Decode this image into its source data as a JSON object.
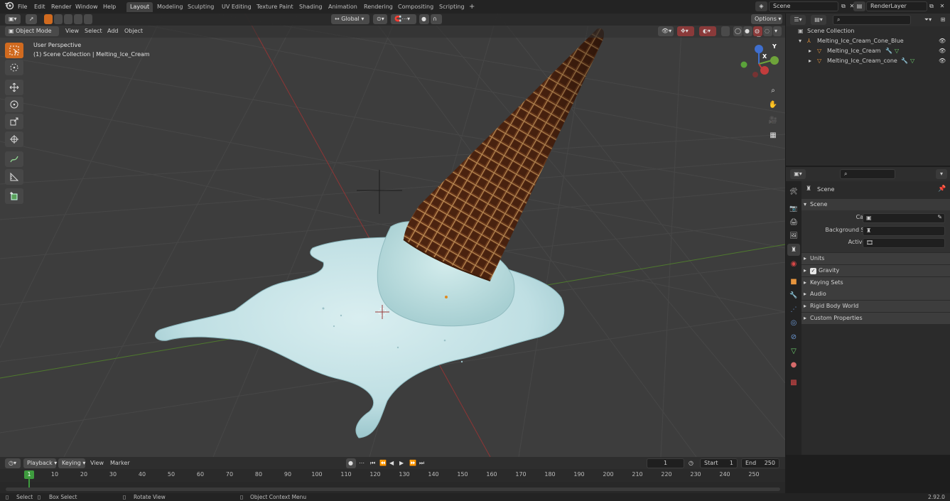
{
  "topbar": {
    "menus": [
      "File",
      "Edit",
      "Render",
      "Window",
      "Help"
    ],
    "workspaces": [
      "Layout",
      "Modeling",
      "Sculpting",
      "UV Editing",
      "Texture Paint",
      "Shading",
      "Animation",
      "Rendering",
      "Compositing",
      "Scripting"
    ],
    "active_workspace": "Layout",
    "add_tab": "+",
    "scene_name": "Scene",
    "layer_name": "RenderLayer"
  },
  "viewport": {
    "mode": "Object Mode",
    "menus": [
      "View",
      "Select",
      "Add",
      "Object"
    ],
    "transform_orientation": "Global",
    "options_label": "Options",
    "info_line1": "User Perspective",
    "info_line2": "(1) Scene Collection | Melting_Ice_Cream",
    "gizmo_axes": {
      "x": "X",
      "y": "Y",
      "z": "Z"
    }
  },
  "outliner": {
    "root": "Scene Collection",
    "items": [
      {
        "name": "Melting_Ice_Cream_Cone_Blue",
        "level": 1
      },
      {
        "name": "Melting_Ice_Cream",
        "level": 2
      },
      {
        "name": "Melting_Ice_Cream_cone",
        "level": 2
      }
    ]
  },
  "properties": {
    "title": "Scene",
    "panel": "Scene",
    "fields": [
      {
        "label": "Camera"
      },
      {
        "label": "Background Scene"
      },
      {
        "label": "Active Clip"
      }
    ],
    "sections": [
      "Units",
      "Gravity",
      "Keying Sets",
      "Audio",
      "Rigid Body World",
      "Custom Properties"
    ],
    "gravity_checked": true
  },
  "timeline": {
    "menus": [
      "Playback",
      "Keying",
      "View",
      "Marker"
    ],
    "current_frame": "1",
    "start_label": "Start",
    "start": "1",
    "end_label": "End",
    "end": "250",
    "playhead": "1",
    "ticks": [
      "10",
      "20",
      "30",
      "40",
      "50",
      "60",
      "70",
      "80",
      "90",
      "100",
      "110",
      "120",
      "130",
      "140",
      "150",
      "160",
      "170",
      "180",
      "190",
      "200",
      "210",
      "220",
      "230",
      "240",
      "250"
    ]
  },
  "statusbar": {
    "items": [
      "Select",
      "Box Select",
      "Rotate View",
      "Object Context Menu"
    ],
    "version": "2.92.0"
  },
  "colors": {
    "accent": "#5680c2",
    "active_tool": "#d06a1f",
    "playhead": "#3e9b3e",
    "x_axis": "#c23c3c",
    "y_axis": "#6ea33a",
    "z_axis": "#3f6fcf"
  }
}
